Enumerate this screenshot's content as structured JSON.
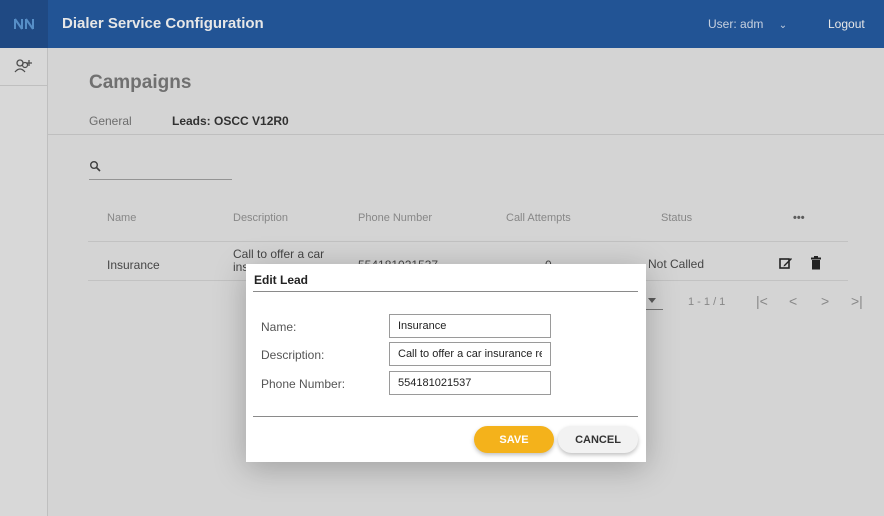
{
  "header": {
    "app_title": "Dialer Service Configuration",
    "user_label": "User:",
    "user_name": "adm",
    "logout_label": "Logout"
  },
  "page": {
    "title": "Campaigns",
    "tabs": [
      {
        "label": "General"
      },
      {
        "label": "Leads: OSCC V12R0"
      }
    ]
  },
  "search": {
    "value": "",
    "placeholder": ""
  },
  "table": {
    "columns": [
      "Name",
      "Description",
      "Phone Number",
      "Call Attempts",
      "Status",
      "•••"
    ],
    "rows": [
      {
        "name": "Insurance",
        "description_line1": "Call to offer a car",
        "description_line2": "ins",
        "phone": "554181021537",
        "attempts": "0",
        "status": "Not Called"
      }
    ]
  },
  "pagination": {
    "range": "1 - 1 / 1",
    "first": "|<",
    "prev": "<",
    "next": ">",
    "last": ">|"
  },
  "dialog": {
    "title": "Edit Lead",
    "fields": [
      {
        "label": "Name:",
        "value": "Insurance"
      },
      {
        "label": "Description:",
        "value": "Call to offer a car insurance renewal"
      },
      {
        "label": "Phone Number:",
        "value": "554181021537"
      }
    ],
    "save_label": "SAVE",
    "cancel_label": "CANCEL"
  },
  "colors": {
    "header": "#0f4c9c",
    "accent": "#f4b21b"
  }
}
